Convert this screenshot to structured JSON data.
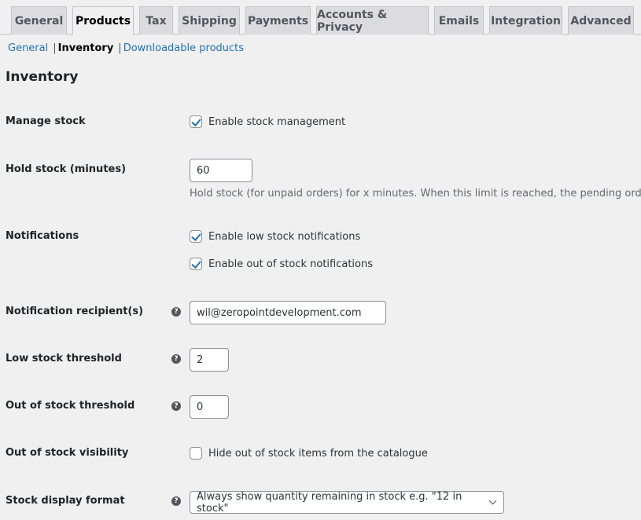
{
  "tabs": [
    {
      "label": "General",
      "active": false
    },
    {
      "label": "Products",
      "active": true
    },
    {
      "label": "Tax",
      "active": false
    },
    {
      "label": "Shipping",
      "active": false
    },
    {
      "label": "Payments",
      "active": false
    },
    {
      "label": "Accounts & Privacy",
      "active": false
    },
    {
      "label": "Emails",
      "active": false
    },
    {
      "label": "Integration",
      "active": false
    },
    {
      "label": "Advanced",
      "active": false
    }
  ],
  "subnav": {
    "general": "General",
    "inventory": "Inventory",
    "downloadable": "Downloadable products",
    "separator": "|"
  },
  "section_title": "Inventory",
  "help_glyph": "?",
  "fields": {
    "manage_stock": {
      "label": "Manage stock",
      "checkbox_label": "Enable stock management",
      "checked": true
    },
    "hold_stock": {
      "label": "Hold stock (minutes)",
      "value": "60",
      "description": "Hold stock (for unpaid orders) for x minutes. When this limit is reached, the pending order wi"
    },
    "notifications": {
      "label": "Notifications",
      "low_stock_label": "Enable low stock notifications",
      "low_stock_checked": true,
      "out_of_stock_label": "Enable out of stock notifications",
      "out_of_stock_checked": true
    },
    "notification_recipient": {
      "label": "Notification recipient(s)",
      "value": "wil@zeropointdevelopment.com"
    },
    "low_stock_threshold": {
      "label": "Low stock threshold",
      "value": "2"
    },
    "out_of_stock_threshold": {
      "label": "Out of stock threshold",
      "value": "0"
    },
    "out_of_stock_visibility": {
      "label": "Out of stock visibility",
      "checkbox_label": "Hide out of stock items from the catalogue",
      "checked": false
    },
    "stock_display_format": {
      "label": "Stock display format",
      "selected": "Always show quantity remaining in stock e.g. \"12 in stock\""
    }
  }
}
